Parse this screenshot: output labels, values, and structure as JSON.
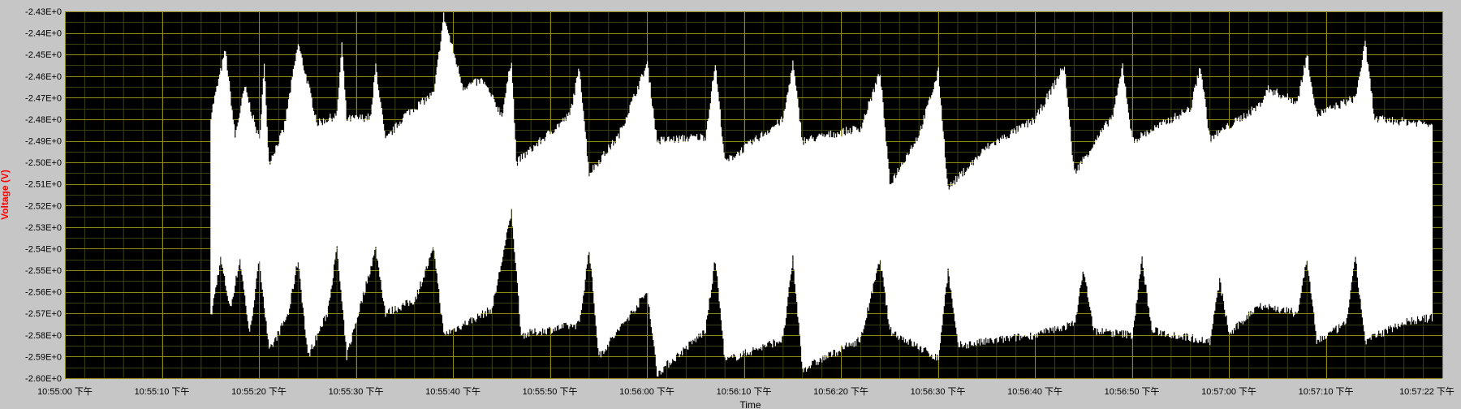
{
  "chart_data": {
    "type": "area",
    "ylabel": "Voltage (V)",
    "xlabel": "Time",
    "ylim": [
      -2.6,
      -2.43
    ],
    "yticks": [
      "-2.43E+0",
      "-2.44E+0",
      "-2.45E+0",
      "-2.46E+0",
      "-2.47E+0",
      "-2.48E+0",
      "-2.49E+0",
      "-2.50E+0",
      "-2.51E+0",
      "-2.52E+0",
      "-2.53E+0",
      "-2.54E+0",
      "-2.55E+0",
      "-2.56E+0",
      "-2.57E+0",
      "-2.58E+0",
      "-2.59E+0",
      "-2.60E+0"
    ],
    "yticks_values": [
      -2.43,
      -2.44,
      -2.45,
      -2.46,
      -2.47,
      -2.48,
      -2.49,
      -2.5,
      -2.51,
      -2.52,
      -2.53,
      -2.54,
      -2.55,
      -2.56,
      -2.57,
      -2.58,
      -2.59,
      -2.6
    ],
    "xlim_seconds_since_10_55_00": [
      0,
      142
    ],
    "xticks": [
      "10:55:00 下午",
      "10:55:10 下午",
      "10:55:20 下午",
      "10:55:30 下午",
      "10:55:40 下午",
      "10:55:50 下午",
      "10:56:00 下午",
      "10:56:10 下午",
      "10:56:20 下午",
      "10:56:30 下午",
      "10:56:40 下午",
      "10:56:50 下午",
      "10:57:00 下午",
      "10:57:10 下午",
      "10:57:22 下午"
    ],
    "xticks_seconds": [
      0,
      10,
      20,
      30,
      40,
      50,
      60,
      70,
      80,
      90,
      100,
      110,
      120,
      130,
      142
    ],
    "grid": true,
    "colors": {
      "plot_bg": "#000000",
      "grid_major": "#8f8a16",
      "grid_minor": "#3a4214",
      "series": "#ffffff",
      "frame_bg": "#c6c6c6",
      "ylabel": "#ff0000"
    },
    "series": [
      {
        "upper_envelope": [
          [
            15,
            -2.478
          ],
          [
            16.5,
            -2.448
          ],
          [
            17.5,
            -2.488
          ],
          [
            18.5,
            -2.465
          ],
          [
            20,
            -2.49
          ],
          [
            20.5,
            -2.455
          ],
          [
            21,
            -2.5
          ],
          [
            22.5,
            -2.485
          ],
          [
            24,
            -2.445
          ],
          [
            26,
            -2.482
          ],
          [
            28,
            -2.478
          ],
          [
            28.5,
            -2.445
          ],
          [
            29,
            -2.48
          ],
          [
            31.5,
            -2.479
          ],
          [
            32,
            -2.455
          ],
          [
            33,
            -2.49
          ],
          [
            35,
            -2.478
          ],
          [
            38,
            -2.468
          ],
          [
            39,
            -2.432
          ],
          [
            41,
            -2.465
          ],
          [
            43,
            -2.462
          ],
          [
            45,
            -2.478
          ],
          [
            46,
            -2.452
          ],
          [
            46.5,
            -2.5
          ],
          [
            52,
            -2.478
          ],
          [
            53,
            -2.456
          ],
          [
            54,
            -2.505
          ],
          [
            57,
            -2.488
          ],
          [
            60,
            -2.454
          ],
          [
            61,
            -2.49
          ],
          [
            66,
            -2.488
          ],
          [
            67,
            -2.454
          ],
          [
            68,
            -2.5
          ],
          [
            74,
            -2.48
          ],
          [
            75,
            -2.454
          ],
          [
            76,
            -2.49
          ],
          [
            82,
            -2.484
          ],
          [
            84,
            -2.458
          ],
          [
            85,
            -2.51
          ],
          [
            88,
            -2.487
          ],
          [
            90,
            -2.458
          ],
          [
            91,
            -2.512
          ],
          [
            95,
            -2.493
          ],
          [
            100,
            -2.48
          ],
          [
            103,
            -2.455
          ],
          [
            104,
            -2.505
          ],
          [
            108,
            -2.478
          ],
          [
            109,
            -2.455
          ],
          [
            110,
            -2.49
          ],
          [
            116,
            -2.475
          ],
          [
            117,
            -2.455
          ],
          [
            118,
            -2.489
          ],
          [
            123,
            -2.474
          ],
          [
            124,
            -2.466
          ],
          [
            127,
            -2.472
          ],
          [
            128,
            -2.45
          ],
          [
            129,
            -2.478
          ],
          [
            133,
            -2.47
          ],
          [
            134,
            -2.445
          ],
          [
            135,
            -2.48
          ],
          [
            141,
            -2.482
          ]
        ],
        "lower_envelope": [
          [
            15,
            -2.572
          ],
          [
            16,
            -2.545
          ],
          [
            17,
            -2.568
          ],
          [
            18,
            -2.545
          ],
          [
            19,
            -2.58
          ],
          [
            20,
            -2.545
          ],
          [
            21,
            -2.588
          ],
          [
            23,
            -2.57
          ],
          [
            24,
            -2.545
          ],
          [
            25,
            -2.59
          ],
          [
            27,
            -2.57
          ],
          [
            28,
            -2.54
          ],
          [
            29,
            -2.59
          ],
          [
            32,
            -2.54
          ],
          [
            33,
            -2.57
          ],
          [
            36,
            -2.564
          ],
          [
            38,
            -2.54
          ],
          [
            39,
            -2.58
          ],
          [
            44,
            -2.568
          ],
          [
            46,
            -2.523
          ],
          [
            47,
            -2.58
          ],
          [
            53,
            -2.575
          ],
          [
            54,
            -2.54
          ],
          [
            55,
            -2.59
          ],
          [
            60,
            -2.56
          ],
          [
            61,
            -2.598
          ],
          [
            66,
            -2.578
          ],
          [
            67,
            -2.545
          ],
          [
            68,
            -2.592
          ],
          [
            74,
            -2.582
          ],
          [
            75,
            -2.545
          ],
          [
            76,
            -2.596
          ],
          [
            82,
            -2.582
          ],
          [
            84,
            -2.545
          ],
          [
            85,
            -2.578
          ],
          [
            90,
            -2.591
          ],
          [
            91,
            -2.55
          ],
          [
            92,
            -2.585
          ],
          [
            100,
            -2.58
          ],
          [
            104,
            -2.575
          ],
          [
            105,
            -2.55
          ],
          [
            106,
            -2.578
          ],
          [
            110,
            -2.58
          ],
          [
            111,
            -2.545
          ],
          [
            112,
            -2.578
          ],
          [
            118,
            -2.583
          ],
          [
            119,
            -2.555
          ],
          [
            120,
            -2.58
          ],
          [
            123,
            -2.566
          ],
          [
            127,
            -2.57
          ],
          [
            128,
            -2.545
          ],
          [
            129,
            -2.583
          ],
          [
            132,
            -2.575
          ],
          [
            133,
            -2.545
          ],
          [
            134,
            -2.583
          ],
          [
            138,
            -2.574
          ],
          [
            141,
            -2.572
          ]
        ]
      }
    ]
  }
}
